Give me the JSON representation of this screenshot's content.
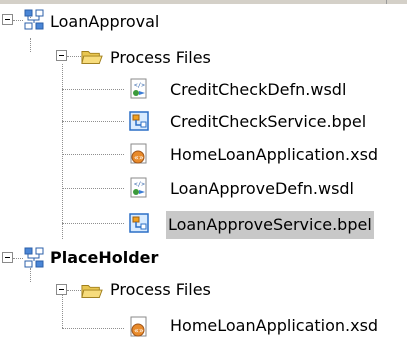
{
  "tree": {
    "projects": [
      {
        "name": "LoanApproval",
        "icon": "project-icon",
        "folder": {
          "name": "Process Files",
          "icon": "folder-open-icon",
          "files": [
            {
              "name": "CreditCheckDefn.wsdl",
              "icon": "wsdl-file-icon"
            },
            {
              "name": "CreditCheckService.bpel",
              "icon": "bpel-file-icon"
            },
            {
              "name": "HomeLoanApplication.xsd",
              "icon": "xsd-file-icon"
            },
            {
              "name": "LoanApproveDefn.wsdl",
              "icon": "wsdl-file-icon"
            },
            {
              "name": "LoanApproveService.bpel",
              "icon": "bpel-file-icon",
              "selected": true
            }
          ]
        }
      },
      {
        "name": "PlaceHolder",
        "icon": "project-icon",
        "folder": {
          "name": "Process Files",
          "icon": "folder-open-icon",
          "files": [
            {
              "name": "HomeLoanApplication.xsd",
              "icon": "xsd-file-icon"
            }
          ]
        }
      }
    ]
  }
}
